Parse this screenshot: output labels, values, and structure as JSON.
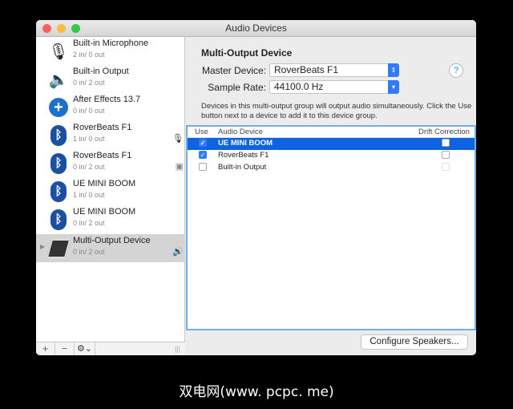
{
  "window": {
    "title": "Audio Devices"
  },
  "sidebar": {
    "devices": [
      {
        "name": "Built-in Microphone",
        "io": "2 in/ 0 out",
        "icon": "microphone-icon"
      },
      {
        "name": "Built-in Output",
        "io": "0 in/ 2 out",
        "icon": "speaker-icon"
      },
      {
        "name": "After Effects 13.7",
        "io": "0 in/ 0 out",
        "icon": "plus-circle-icon"
      },
      {
        "name": "RoverBeats F1",
        "io": "1 in/ 0 out",
        "icon": "bluetooth-icon"
      },
      {
        "name": "RoverBeats F1",
        "io": "0 in/ 2 out",
        "icon": "bluetooth-icon"
      },
      {
        "name": "UE MINI BOOM",
        "io": "1 in/ 0 out",
        "icon": "bluetooth-icon"
      },
      {
        "name": "UE MINI BOOM",
        "io": "0 in/ 2 out",
        "icon": "bluetooth-icon"
      },
      {
        "name": "Multi-Output Device",
        "io": "0 in/ 2 out",
        "icon": "multi-output-icon",
        "selected": true
      }
    ],
    "add": "+",
    "remove": "−",
    "gear": "⚙⌄"
  },
  "main": {
    "title": "Multi-Output Device",
    "master_label": "Master Device:",
    "master_value": "RoverBeats F1",
    "rate_label": "Sample Rate:",
    "rate_value": "44100.0 Hz",
    "help": "?",
    "description": "Devices in this multi-output group will output audio simultaneously. Click the Use button next to a device to add it to this device group.",
    "table": {
      "headers": [
        "Use",
        "Audio Device",
        "Drift Correction"
      ],
      "rows": [
        {
          "use": true,
          "device": "UE MINI BOOM",
          "drift": false
        },
        {
          "use": true,
          "device": "RoverBeats F1",
          "drift": false
        },
        {
          "use": false,
          "device": "Built-in Output",
          "drift": false
        }
      ]
    },
    "configure": "Configure Speakers..."
  },
  "caption": "双电网(www. pcpc. me)"
}
